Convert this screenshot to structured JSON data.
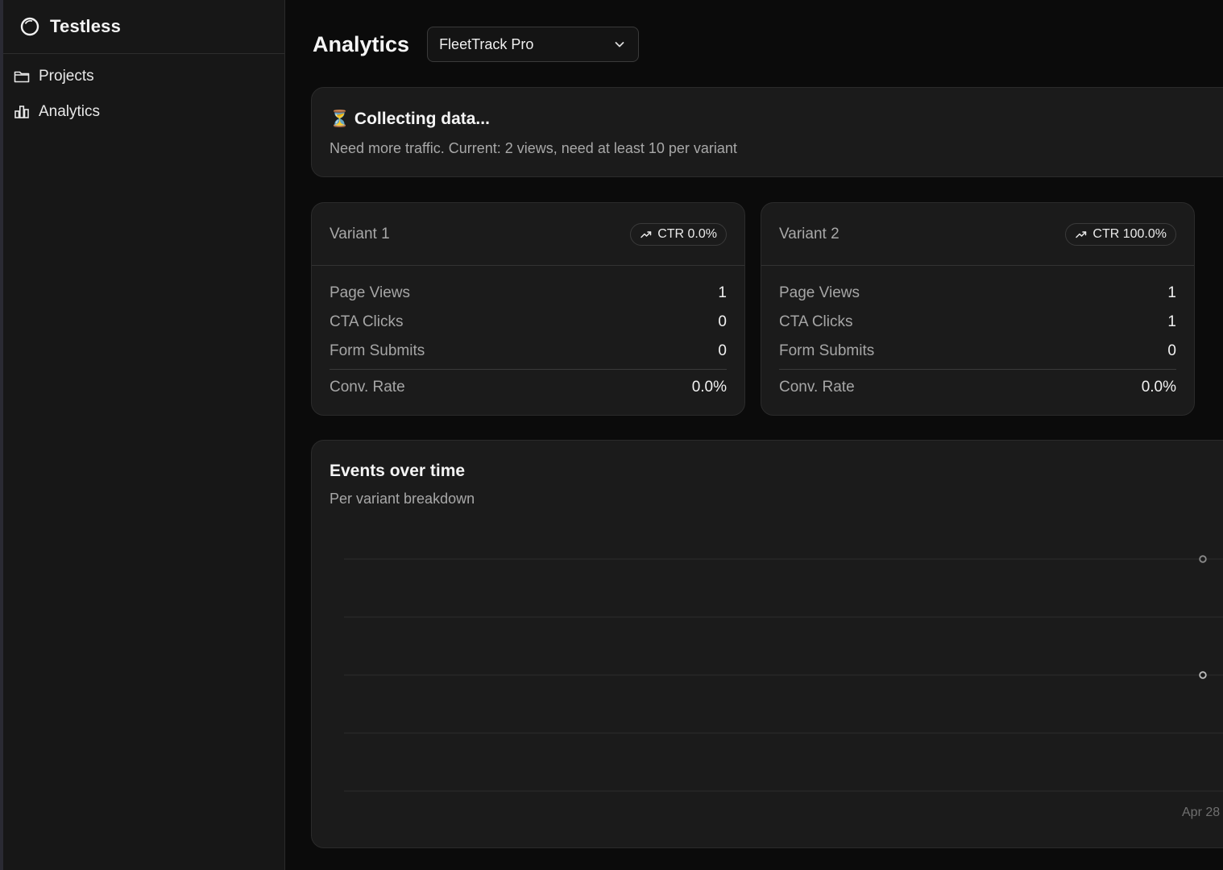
{
  "app": {
    "name": "Testless"
  },
  "sidebar": {
    "items": [
      {
        "label": "Projects",
        "icon": "folder-icon"
      },
      {
        "label": "Analytics",
        "icon": "bar-chart-icon"
      }
    ]
  },
  "header": {
    "title": "Analytics",
    "project_select": {
      "value": "FleetTrack Pro"
    }
  },
  "notice": {
    "icon": "hourglass-icon",
    "emoji": "⏳",
    "title": "Collecting data...",
    "message": "Need more traffic. Current: 2 views, need at least 10 per variant"
  },
  "variants": [
    {
      "name": "Variant 1",
      "ctr": "CTR 0.0%",
      "metrics": [
        {
          "label": "Page Views",
          "value": "1"
        },
        {
          "label": "CTA Clicks",
          "value": "0"
        },
        {
          "label": "Form Submits",
          "value": "0"
        }
      ],
      "conv": {
        "label": "Conv. Rate",
        "value": "0.0%"
      }
    },
    {
      "name": "Variant 2",
      "ctr": "CTR 100.0%",
      "metrics": [
        {
          "label": "Page Views",
          "value": "1"
        },
        {
          "label": "CTA Clicks",
          "value": "1"
        },
        {
          "label": "Form Submits",
          "value": "0"
        }
      ],
      "conv": {
        "label": "Conv. Rate",
        "value": "0.0%"
      }
    }
  ],
  "chart": {
    "title": "Events over time",
    "subtitle": "Per variant breakdown"
  },
  "chart_data": {
    "type": "line",
    "title": "Events over time",
    "subtitle": "Per variant breakdown",
    "categories": [
      "Apr 28"
    ],
    "ylim": [
      0,
      4
    ],
    "grid": true,
    "series": [
      {
        "values": [
          4
        ],
        "color": "#8a8a8a"
      },
      {
        "values": [
          2
        ],
        "color": "#bdbdbd"
      }
    ]
  },
  "colors": {
    "background": "#0b0b0b",
    "sidebar": "#171717",
    "card": "#1b1b1b",
    "border": "#2b2b2b",
    "muted_text": "#a8a8a8",
    "text": "#f2f2f2"
  }
}
